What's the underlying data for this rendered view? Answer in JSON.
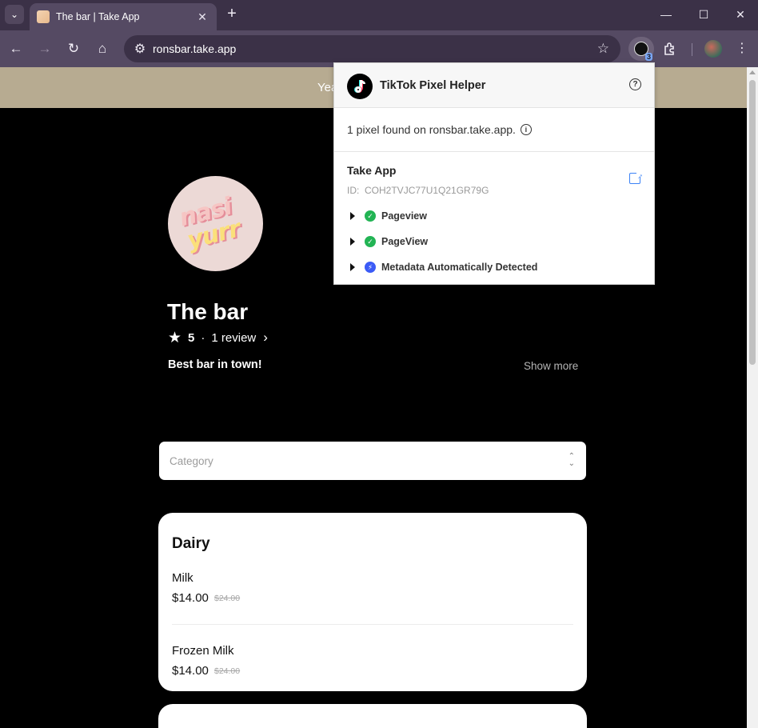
{
  "browser": {
    "tab_title": "The bar | Take App",
    "url": "ronsbar.take.app",
    "extension_badge": "3",
    "icons": {
      "tab_search": "chevron-down-icon",
      "close_tab": "close-icon",
      "new_tab": "plus-icon",
      "minimize": "minimize-icon",
      "maximize": "maximize-icon",
      "close_window": "close-icon",
      "back": "arrow-left-icon",
      "forward": "arrow-right-icon",
      "reload": "reload-icon",
      "home": "home-icon",
      "site_info": "tune-icon",
      "bookmark": "star-icon",
      "extensions": "puzzle-icon",
      "menu": "kebab-icon"
    }
  },
  "page": {
    "banner_text": "Yea",
    "store": {
      "logo_line1": "nasi",
      "logo_line2": "yurr",
      "name": "The bar",
      "rating": "5",
      "separator": "·",
      "review_count": "1 review",
      "description": "Best bar in town!",
      "show_more": "Show more"
    },
    "category": {
      "placeholder": "Category"
    },
    "sections": [
      {
        "title": "Dairy",
        "items": [
          {
            "name": "Milk",
            "price": "$14.00",
            "original_price": "$24.00"
          },
          {
            "name": "Frozen Milk",
            "price": "$14.00",
            "original_price": "$24.00"
          }
        ]
      }
    ]
  },
  "tiktok_popup": {
    "title": "TikTok Pixel Helper",
    "found_text": "1 pixel found on ronsbar.take.app.",
    "pixel": {
      "name": "Take App",
      "id_label": "ID:",
      "id": "COH2TVJC77U1Q21GR79G"
    },
    "events": [
      {
        "label": "Pageview",
        "status": "success"
      },
      {
        "label": "PageView",
        "status": "success"
      },
      {
        "label": "Metadata Automatically Detected",
        "status": "info"
      }
    ]
  },
  "colors": {
    "chrome_dark": "#3b3147",
    "chrome_mid": "#554a63",
    "banner": "#b7ab91",
    "success": "#22b454",
    "info": "#3b5bf6",
    "link": "#3b82f6"
  }
}
